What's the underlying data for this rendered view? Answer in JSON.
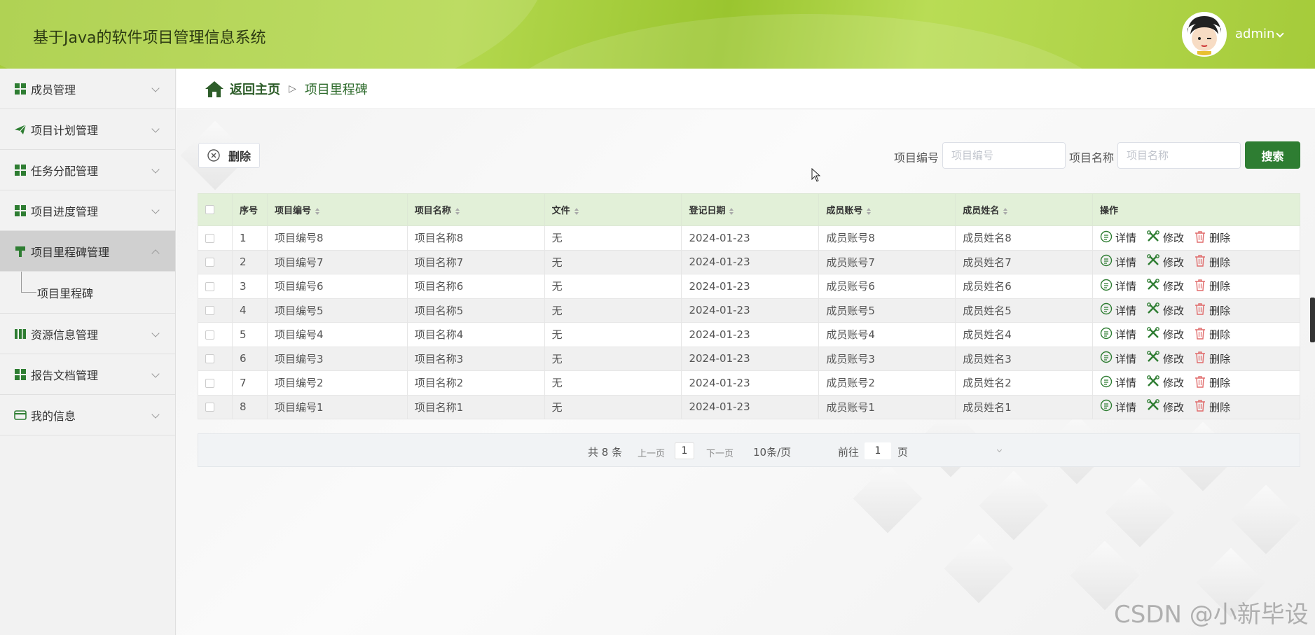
{
  "header": {
    "app_title": "基于Java的软件项目管理信息系统",
    "user_name": "admin",
    "accent_color": "#a6cc3d"
  },
  "sidebar": {
    "items": [
      {
        "label": "成员管理",
        "icon": "grid-icon"
      },
      {
        "label": "项目计划管理",
        "icon": "send-icon"
      },
      {
        "label": "任务分配管理",
        "icon": "grid-icon"
      },
      {
        "label": "项目进度管理",
        "icon": "grid-icon"
      },
      {
        "label": "项目里程碑管理",
        "icon": "flag-icon",
        "expanded": true
      },
      {
        "label": "资源信息管理",
        "icon": "book-icon"
      },
      {
        "label": "报告文档管理",
        "icon": "grid-icon"
      },
      {
        "label": "我的信息",
        "icon": "card-icon"
      }
    ],
    "submenu": {
      "label": "项目里程碑"
    }
  },
  "breadcrumb": {
    "home": "返回主页",
    "separator": "▷",
    "current": "项目里程碑"
  },
  "toolbar": {
    "delete_label": "删除",
    "search": {
      "field1_label": "项目编号",
      "field1_placeholder": "项目编号",
      "field2_label": "项目名称",
      "field2_placeholder": "项目名称",
      "button_label": "搜索"
    }
  },
  "table": {
    "headers": [
      "序号",
      "项目编号",
      "项目名称",
      "文件",
      "登记日期",
      "成员账号",
      "成员姓名",
      "操作"
    ],
    "actions": {
      "detail": "详情",
      "edit": "修改",
      "delete": "删除"
    },
    "rows": [
      {
        "no": "1",
        "code": "项目编号8",
        "name": "项目名称8",
        "file": "无",
        "date": "2024-01-23",
        "account": "成员账号8",
        "member": "成员姓名8"
      },
      {
        "no": "2",
        "code": "项目编号7",
        "name": "项目名称7",
        "file": "无",
        "date": "2024-01-23",
        "account": "成员账号7",
        "member": "成员姓名7"
      },
      {
        "no": "3",
        "code": "项目编号6",
        "name": "项目名称6",
        "file": "无",
        "date": "2024-01-23",
        "account": "成员账号6",
        "member": "成员姓名6"
      },
      {
        "no": "4",
        "code": "项目编号5",
        "name": "项目名称5",
        "file": "无",
        "date": "2024-01-23",
        "account": "成员账号5",
        "member": "成员姓名5"
      },
      {
        "no": "5",
        "code": "项目编号4",
        "name": "项目名称4",
        "file": "无",
        "date": "2024-01-23",
        "account": "成员账号4",
        "member": "成员姓名4"
      },
      {
        "no": "6",
        "code": "项目编号3",
        "name": "项目名称3",
        "file": "无",
        "date": "2024-01-23",
        "account": "成员账号3",
        "member": "成员姓名3"
      },
      {
        "no": "7",
        "code": "项目编号2",
        "name": "项目名称2",
        "file": "无",
        "date": "2024-01-23",
        "account": "成员账号2",
        "member": "成员姓名2"
      },
      {
        "no": "8",
        "code": "项目编号1",
        "name": "项目名称1",
        "file": "无",
        "date": "2024-01-23",
        "account": "成员账号1",
        "member": "成员姓名1"
      }
    ]
  },
  "pagination": {
    "total": "共 8 条",
    "prev": "上一页",
    "page": "1",
    "next": "下一页",
    "page_size": "10条/页",
    "goto_label": "前往",
    "goto_value": "1",
    "page_suffix": "页"
  },
  "watermark": "CSDN @小新毕设"
}
